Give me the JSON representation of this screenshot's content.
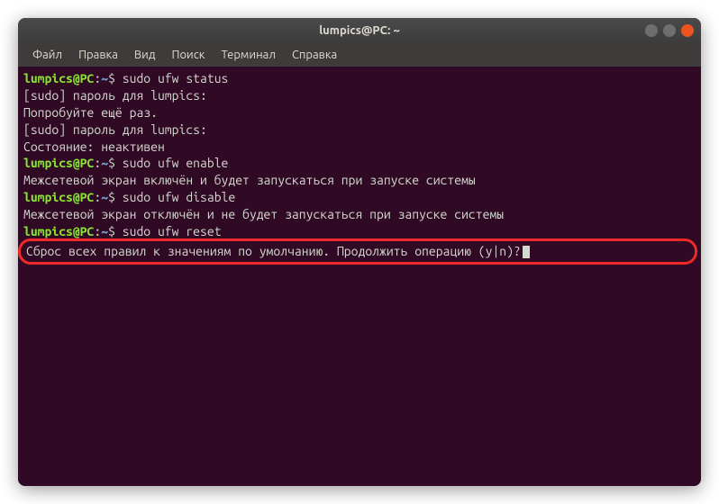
{
  "titlebar": {
    "title": "lumpics@PC: ~"
  },
  "menubar": {
    "items": [
      "Файл",
      "Правка",
      "Вид",
      "Поиск",
      "Терминал",
      "Справка"
    ]
  },
  "prompt": {
    "user": "lumpics@PC",
    "sep1": ":",
    "path": "~",
    "sep2": "$ "
  },
  "terminal": {
    "lines": [
      {
        "type": "prompt",
        "cmd": "sudo ufw status"
      },
      {
        "type": "output",
        "text": "[sudo] пароль для lumpics:"
      },
      {
        "type": "output",
        "text": "Попробуйте ещё раз."
      },
      {
        "type": "output",
        "text": "[sudo] пароль для lumpics:"
      },
      {
        "type": "output",
        "text": "Состояние: неактивен"
      },
      {
        "type": "prompt",
        "cmd": "sudo ufw enable"
      },
      {
        "type": "output",
        "text": "Межсетевой экран включён и будет запускаться при запуске системы"
      },
      {
        "type": "prompt",
        "cmd": "sudo ufw disable"
      },
      {
        "type": "output",
        "text": "Межсетевой экран отключён и не будет запускаться при запуске системы"
      },
      {
        "type": "prompt",
        "cmd": "sudo ufw reset"
      }
    ],
    "highlighted_line": "Сброс всех правил к значениям по умолчанию. Продолжить операцию (y|n)?"
  }
}
